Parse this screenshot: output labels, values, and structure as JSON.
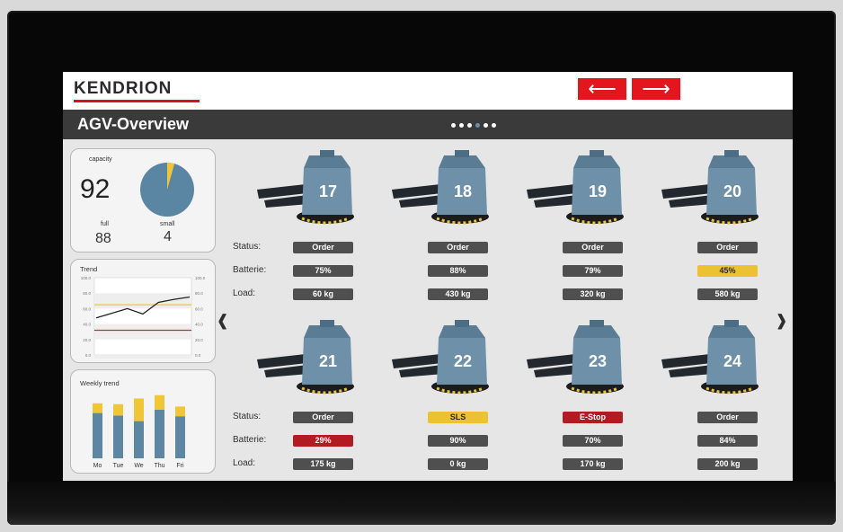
{
  "header": {
    "logo": "KENDRION",
    "back_arrow": "⟵",
    "forward_arrow": "⟶"
  },
  "titlebar": {
    "title": "AGV-Overview",
    "dots_total": 6,
    "dots_active": 4
  },
  "capacity": {
    "title": "capacity",
    "value": "92",
    "full_label": "full",
    "full_value": "88",
    "small_label": "small",
    "small_value": "4",
    "pie": {
      "full": 88,
      "small": 4
    }
  },
  "trend": {
    "title": "Trend",
    "y_ticks": [
      "100.0",
      "80.0",
      "60.0",
      "40.0",
      "20.0",
      "0.0"
    ],
    "series": [
      48,
      54,
      60,
      53,
      68,
      72,
      75
    ],
    "upper_limit": 65,
    "lower_limit": 32
  },
  "weekly": {
    "title": "Weekly trend",
    "days": [
      "Mo",
      "Tue",
      "We",
      "Thu",
      "Fri"
    ],
    "base": [
      56,
      53,
      46,
      60,
      52
    ],
    "top": [
      12,
      14,
      28,
      18,
      12
    ]
  },
  "nav": {
    "prev": "‹",
    "next": "›"
  },
  "labels": {
    "status": "Status:",
    "battery": "Batterie:",
    "load": "Load:"
  },
  "agvs": [
    {
      "id": "17",
      "status": "Order",
      "status_color": "gray",
      "battery": "75%",
      "battery_color": "gray",
      "load": "60 kg"
    },
    {
      "id": "18",
      "status": "Order",
      "status_color": "gray",
      "battery": "88%",
      "battery_color": "gray",
      "load": "430 kg"
    },
    {
      "id": "19",
      "status": "Order",
      "status_color": "gray",
      "battery": "79%",
      "battery_color": "gray",
      "load": "320 kg"
    },
    {
      "id": "20",
      "status": "Order",
      "status_color": "gray",
      "battery": "45%",
      "battery_color": "yellow",
      "load": "580 kg"
    },
    {
      "id": "21",
      "status": "Order",
      "status_color": "gray",
      "battery": "29%",
      "battery_color": "red",
      "load": "175 kg"
    },
    {
      "id": "22",
      "status": "SLS",
      "status_color": "yellow",
      "battery": "90%",
      "battery_color": "gray",
      "load": "0 kg"
    },
    {
      "id": "23",
      "status": "E-Stop",
      "status_color": "red",
      "battery": "70%",
      "battery_color": "gray",
      "load": "170 kg"
    },
    {
      "id": "24",
      "status": "Order",
      "status_color": "gray",
      "battery": "84%",
      "battery_color": "gray",
      "load": "200 kg"
    }
  ],
  "colors": {
    "accent": "#e3161d",
    "agv_body": "#6e91a9",
    "pie_full": "#5b86a3",
    "pie_small": "#f0c637",
    "bar": "#5d86a2",
    "bar_top": "#f0c637"
  }
}
